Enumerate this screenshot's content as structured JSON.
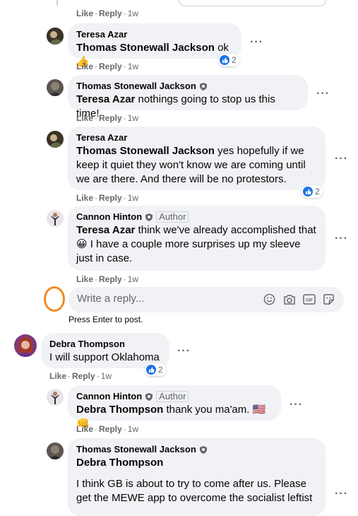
{
  "actions": {
    "like": "Like",
    "reply": "Reply",
    "separator": "·",
    "time": "1w"
  },
  "comments": [
    {
      "author": "Teresa Azar",
      "mention": "Thomas Stonewall Jackson",
      "text": " ok ",
      "emoji": "👍",
      "reactions": "2"
    },
    {
      "author": "Thomas Stonewall Jackson",
      "mention": "Teresa Azar",
      "text": " nothings going to stop us this time!"
    },
    {
      "author": "Teresa Azar",
      "mention": "Thomas Stonewall Jackson",
      "text": " yes hopefully if we keep it quiet they won't know we are coming until we are there. And there will be no protestors.",
      "reactions": "2"
    },
    {
      "author": "Cannon Hinton",
      "badge": "Author",
      "mention": "Teresa Azar",
      "text": " think we've already accomplished that ",
      "emoji": "😀",
      "text2": " I have a couple more surprises up my sleeve just in case."
    },
    {
      "author": "Debra Thompson",
      "text": "I will support Oklahoma",
      "reactions": "2"
    },
    {
      "author": "Cannon Hinton",
      "badge": "Author",
      "mention": "Debra Thompson",
      "text": " thank you ma'am. ",
      "emoji": "🇺🇸👊"
    },
    {
      "author": "Thomas Stonewall Jackson",
      "mention": "Debra Thompson",
      "text": "I think GB is about to try to come after us. Please get the MEWE app to overcome the socialist leftist"
    }
  ],
  "reply_box": {
    "placeholder": "Write a reply...",
    "hint": "Press Enter to post."
  },
  "icons": [
    "emoji-icon",
    "camera-icon",
    "gif-icon",
    "sticker-icon",
    "like-reaction-icon",
    "verified-shield-icon",
    "more-options-icon"
  ],
  "colors": {
    "bubble": "#f0f2f5",
    "secondary_text": "#65676b",
    "like_blue": "#1b74e4",
    "highlight_circle": "#f08a24"
  }
}
